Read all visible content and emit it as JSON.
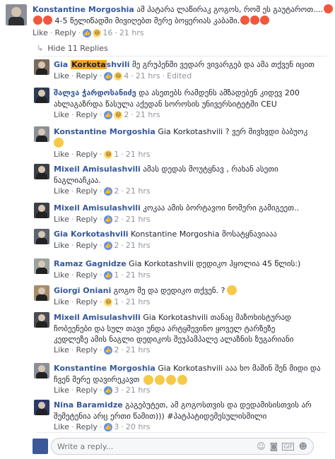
{
  "top": {
    "name": "Konstantine Morgoshia",
    "text1": "ამ პატარა ლაწირაკ გოგოს, რომ ეს გაუტაროთ....",
    "text2": "4-5 წელიწადში მივიღებთ მერე ბოყერიას კაბაში.",
    "like": "Like",
    "reply": "Reply",
    "reactions": "16",
    "time": "21 hrs"
  },
  "hide_replies": "Hide 11 Replies",
  "replies": [
    {
      "name_pre": "Gia ",
      "name_hl": "Korkota",
      "name_post": "shvili",
      "text": " მე გრუპენში ვედარ ვივარგებ და ამა თქვენ იცით",
      "text2": "",
      "like": "Like",
      "reply": "Reply",
      "count": "4",
      "time": "21 hrs",
      "edited": "Edited"
    },
    {
      "name": "შალვა ჭარდოსანიძე",
      "text": " და ასეთებს რამდენს ამზადებენ კიდევ 200",
      "text2": "ახლაგაზრდა წასულა აქედან სოროსის უნივერსიტეტში CEU",
      "like": "Like",
      "reply": "Reply",
      "count": "2",
      "time": "21 hrs"
    },
    {
      "name": "Konstantine Morgoshia",
      "text": " Gia Korkotashvili ? ვერ მივხვდი ბაბუოკ",
      "text2": "",
      "like": "Like",
      "reply": "Reply",
      "count": "1",
      "time": "21 hrs"
    },
    {
      "name": "Mixeil Amisulashvili",
      "text": " ამას დედას მოუტყნავ , რახან ასეთი",
      "text2": "ნაგლიაჩკაა.",
      "like": "Like",
      "reply": "Reply",
      "count": "2",
      "time": "21 hrs"
    },
    {
      "name": "Mixeil Amisulashvili",
      "text": " კოკაა ამის ბორტავოი ნომერი გამიგეეთ..",
      "text2": "",
      "like": "Like",
      "reply": "Reply",
      "count": "2",
      "time": "21 hrs"
    },
    {
      "name": "Gia Korkotashvili",
      "text": " Konstantine Morgoshia მოსატყნავიააა",
      "text2": "",
      "like": "Like",
      "reply": "Reply",
      "count": "2",
      "time": "21 hrs"
    },
    {
      "name": "Ramaz Gagnidze",
      "text": " Gia Korkotashvili დედიკო ჰყოლია 45 წლის:)",
      "text2": "",
      "like": "Like",
      "reply": "Reply",
      "count": "1",
      "time": "21 hrs"
    },
    {
      "name": "Giorgi Oniani",
      "text": " გოგო მე და დედიკო თქვენ. ?",
      "text2": "",
      "like": "Like",
      "reply": "Reply",
      "count": "1",
      "time": "21 hrs"
    },
    {
      "name": "Mixeil Amisulashvili",
      "text": " Gia Korkotashvili თანაც მაზოხისტურად",
      "text2": "ჩობეენები და სულ თავი უნდა არტყმევინო ყოველ ტარზეზე",
      "text3": "კედლეზე ამის ნაგლი დედიკოს შეუპამპალე ალაზნის ზუგარიანი",
      "like": "Like",
      "reply": "Reply",
      "count": "2",
      "time": "21 hrs"
    },
    {
      "name": "Konstantine Morgoshia",
      "text": " Gia Korkotashvili ააა ხო მაშინ შენ მიდი და",
      "text2": "ჩვენ მერე დავირეკავთ",
      "like": "Like",
      "reply": "Reply",
      "count": "3",
      "time": "21 hrs"
    },
    {
      "name": "Nina Baramidze",
      "text": " გაგებუტეთ, ამ გოგოსთვის და დედამისისთვის არ",
      "text2": "შემეტენია არც ერთი წამით))) #პატპატიდემესულისმილი",
      "like": "Like",
      "reply": "Reply",
      "count": "3",
      "time": "20 hrs"
    }
  ],
  "write_placeholder": "Write a reply..."
}
